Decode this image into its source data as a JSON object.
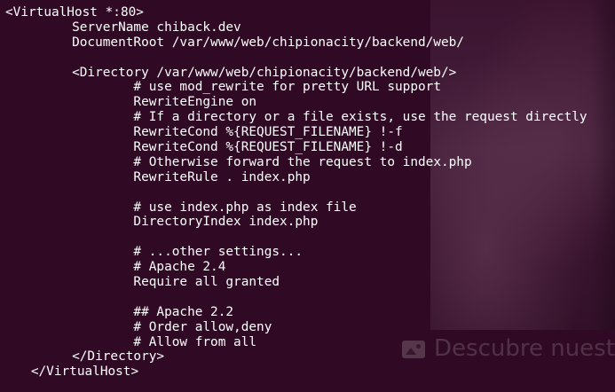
{
  "background": {
    "caption": "Descubre nuest",
    "icon": "image-icon"
  },
  "config_lines": [
    {
      "indent": 1,
      "text": "<VirtualHost *:80>"
    },
    {
      "indent": 2,
      "text": "ServerName chiback.dev"
    },
    {
      "indent": 2,
      "text": "DocumentRoot /var/www/web/chipionacity/backend/web/"
    },
    {
      "indent": 0,
      "text": ""
    },
    {
      "indent": 2,
      "text": "<Directory /var/www/web/chipionacity/backend/web/>"
    },
    {
      "indent": 3,
      "text": "# use mod_rewrite for pretty URL support"
    },
    {
      "indent": 3,
      "text": "RewriteEngine on"
    },
    {
      "indent": 3,
      "text": "# If a directory or a file exists, use the request directly"
    },
    {
      "indent": 3,
      "text": "RewriteCond %{REQUEST_FILENAME} !-f"
    },
    {
      "indent": 3,
      "text": "RewriteCond %{REQUEST_FILENAME} !-d"
    },
    {
      "indent": 3,
      "text": "# Otherwise forward the request to index.php"
    },
    {
      "indent": 3,
      "text": "RewriteRule . index.php"
    },
    {
      "indent": 0,
      "text": ""
    },
    {
      "indent": 3,
      "text": "# use index.php as index file"
    },
    {
      "indent": 3,
      "text": "DirectoryIndex index.php"
    },
    {
      "indent": 0,
      "text": ""
    },
    {
      "indent": 3,
      "text": "# ...other settings..."
    },
    {
      "indent": 3,
      "text": "# Apache 2.4"
    },
    {
      "indent": 3,
      "text": "Require all granted"
    },
    {
      "indent": 0,
      "text": ""
    },
    {
      "indent": 3,
      "text": "## Apache 2.2"
    },
    {
      "indent": 3,
      "text": "# Order allow,deny"
    },
    {
      "indent": 3,
      "text": "# Allow from all"
    },
    {
      "indent": 2,
      "text": "</Directory>"
    },
    {
      "indent": 4,
      "text": "</VirtualHost>"
    }
  ],
  "colors": {
    "terminal_background": "#300a24",
    "text": "#ffffff"
  }
}
